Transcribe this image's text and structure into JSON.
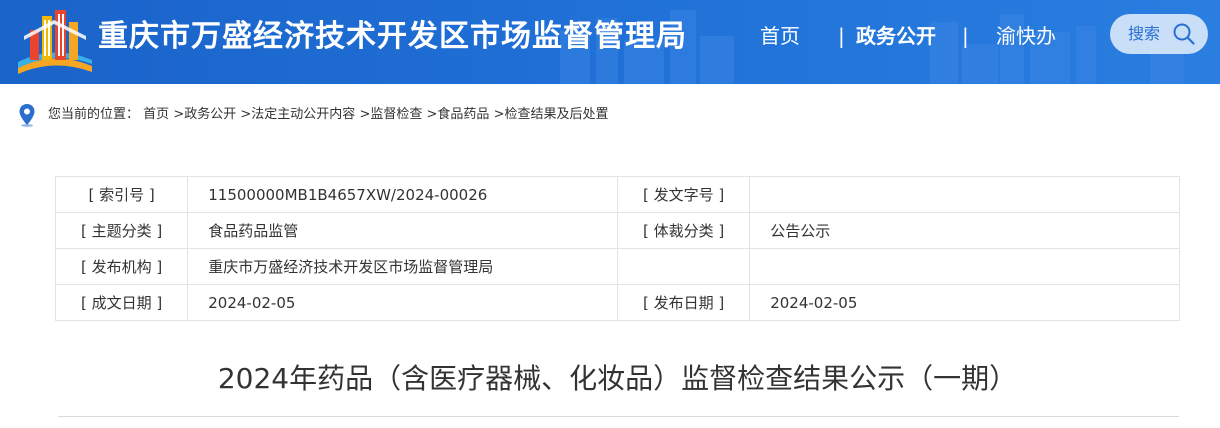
{
  "header": {
    "site_title": "重庆市万盛经济技术开发区市场监督管理局",
    "nav": {
      "home": "首页",
      "separator": "|",
      "gov_affairs": "政务公开",
      "yu_kuai_ban": "渝快办"
    },
    "search_label": "搜索"
  },
  "breadcrumb": {
    "prefix": "您当前的位置：",
    "items": [
      "首页",
      "政务公开",
      "法定主动公开内容",
      "监督检查",
      "食品药品",
      "检查结果及后处置"
    ],
    "separator": " >"
  },
  "meta": {
    "rows": [
      {
        "label1": "[ 索引号 ]",
        "value1": "11500000MB1B4657XW/2024-00026",
        "label2": "[ 发文字号 ]",
        "value2": ""
      },
      {
        "label1": "[ 主题分类 ]",
        "value1": "食品药品监管",
        "label2": "[ 体裁分类 ]",
        "value2": "公告公示"
      },
      {
        "label1": "[ 发布机构 ]",
        "value1": "重庆市万盛经济技术开发区市场监督管理局",
        "label2": "",
        "value2": ""
      },
      {
        "label1": "[ 成文日期 ]",
        "value1": "2024-02-05",
        "label2": "[ 发布日期 ]",
        "value2": "2024-02-05"
      }
    ]
  },
  "article": {
    "title": "2024年药品（含医疗器械、化妆品）监督检查结果公示（一期）"
  },
  "colors": {
    "header_blue": "#1f6fd6",
    "pin_blue": "#2a6fd0",
    "text": "#333333"
  }
}
